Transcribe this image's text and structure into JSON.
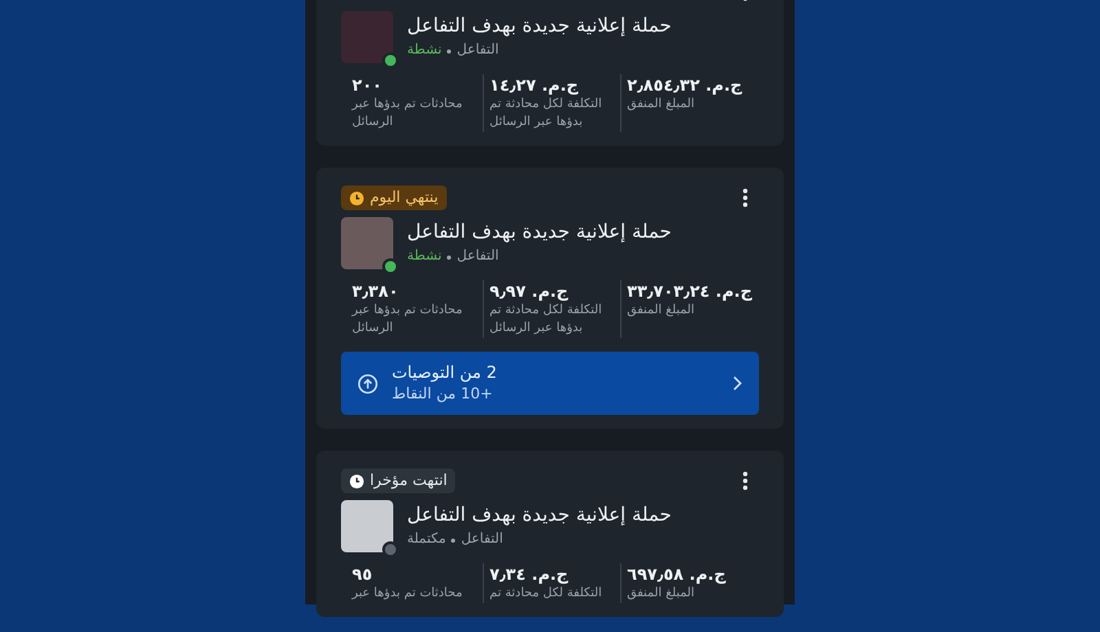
{
  "cards": [
    {
      "title": "حملة إعلانية جديدة بهدف التفاعل",
      "objective": "التفاعل",
      "status": {
        "label": "نشطة",
        "kind": "active"
      },
      "metrics": [
        {
          "value": "ج.م. ٢٫٨٥٤٫٣٢",
          "label": "المبلغ المنفق"
        },
        {
          "value": "ج.م. ١٤٫٢٧",
          "label": "التكلفة لكل محادثة تم بدؤها عبر الرسائل"
        },
        {
          "value": "٢٠٠",
          "label": "محادثات تم بدؤها عبر الرسائل"
        }
      ]
    },
    {
      "badge": {
        "label": "ينتهي اليوم",
        "kind": "ending"
      },
      "title": "حملة إعلانية جديدة بهدف التفاعل",
      "objective": "التفاعل",
      "status": {
        "label": "نشطة",
        "kind": "active"
      },
      "metrics": [
        {
          "value": "ج.م. ٣٣٫٧٠٣٫٢٤",
          "label": "المبلغ المنفق"
        },
        {
          "value": "ج.م. ٩٫٩٧",
          "label": "التكلفة لكل محادثة تم بدؤها عبر الرسائل"
        },
        {
          "value": "٣٫٣٨٠",
          "label": "محادثات تم بدؤها عبر الرسائل"
        }
      ],
      "recommendation": {
        "title": "2 من التوصيات",
        "subtitle": "+10 من النقاط"
      }
    },
    {
      "badge": {
        "label": "انتهت مؤخرا",
        "kind": "ended"
      },
      "title": "حملة إعلانية جديدة بهدف التفاعل",
      "objective": "التفاعل",
      "status": {
        "label": "مكتملة",
        "kind": "completed"
      },
      "metrics": [
        {
          "value": "ج.م. ٦٩٧٫٥٨",
          "label": "المبلغ المنفق"
        },
        {
          "value": "ج.م. ٧٫٣٤",
          "label": "التكلفة لكل محادثة تم"
        },
        {
          "value": "٩٥",
          "label": "محادثات تم بدؤها عبر"
        }
      ]
    }
  ]
}
